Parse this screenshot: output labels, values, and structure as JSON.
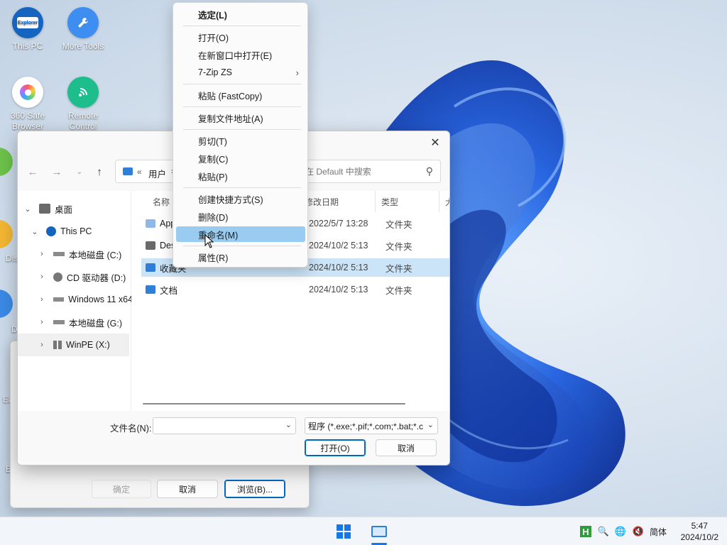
{
  "desktop": {
    "icons": [
      {
        "label": "This PC",
        "icon": "explorer-icon",
        "badge": "Explorer"
      },
      {
        "label": "More Tools",
        "icon": "wrench-icon"
      },
      {
        "label": "360 Safe Browser",
        "icon": "browser-icon"
      },
      {
        "label": "Remote Control",
        "icon": "remote-control-icon"
      }
    ],
    "partial_labels": [
      "Dis",
      "D",
      "Ea",
      "E"
    ]
  },
  "context_menu": {
    "items": [
      {
        "label": "选定(L)",
        "bold": true
      },
      {
        "label": "打开(O)"
      },
      {
        "label": "在新窗口中打开(E)"
      },
      {
        "label": "7-Zip ZS",
        "submenu": true
      },
      {
        "label": "粘贴 (FastCopy)"
      },
      {
        "label": "复制文件地址(A)"
      },
      {
        "label": "剪切(T)"
      },
      {
        "label": "复制(C)"
      },
      {
        "label": "粘贴(P)"
      },
      {
        "label": "创建快捷方式(S)"
      },
      {
        "label": "删除(D)"
      },
      {
        "label": "重命名(M)",
        "highlighted": true
      },
      {
        "label": "属性(R)"
      }
    ]
  },
  "file_dialog": {
    "address": {
      "prefix": "«",
      "crumb": "用户",
      "sep": "›"
    },
    "search_placeholder": "在 Default 中搜索",
    "nav_tree": [
      {
        "label": "桌面",
        "icon": "desktop-icon"
      },
      {
        "label": "This PC",
        "icon": "this-pc-icon"
      },
      {
        "label": "本地磁盘 (C:)",
        "icon": "drive-icon"
      },
      {
        "label": "CD 驱动器 (D:)",
        "icon": "cd-drive-icon"
      },
      {
        "label": "Windows 11 x64",
        "icon": "drive-icon"
      },
      {
        "label": "本地磁盘 (G:)",
        "icon": "drive-icon"
      },
      {
        "label": "WinPE (X:)",
        "icon": "winpe-drive-icon"
      }
    ],
    "columns": {
      "name": "名称",
      "date": "修改日期",
      "type": "类型",
      "size": "大"
    },
    "files": [
      {
        "name": "App",
        "date": "2022/5/7 13:28",
        "type": "文件夹",
        "icon": "folder-icon"
      },
      {
        "name": "Des",
        "date": "2024/10/2 5:13",
        "type": "文件夹",
        "icon": "desktop-folder-icon"
      },
      {
        "name": "收藏夹",
        "date": "2024/10/2 5:13",
        "type": "文件夹",
        "icon": "favorites-folder-icon",
        "selected": true
      },
      {
        "name": "文档",
        "date": "2024/10/2 5:13",
        "type": "文件夹",
        "icon": "documents-folder-icon"
      }
    ],
    "filename_label": "文件名(N):",
    "filename_value": "",
    "filetype_value": "程序 (*.exe;*.pif;*.com;*.bat;*.c",
    "open_button": "打开(O)",
    "cancel_button": "取消"
  },
  "browse_dialog": {
    "ok_button": "确定",
    "cancel_button": "取消",
    "browse_button": "浏览(B)..."
  },
  "taskbar": {
    "tray": {
      "ime": "简体"
    },
    "clock": {
      "time": "5:47",
      "date": "2024/10/2"
    }
  },
  "colors": {
    "accent": "#0067c0",
    "selection": "#cce4f7",
    "menu_highlight": "#99ccf0",
    "folder": "#f5c242",
    "blue_folder": "#2f7fd8"
  }
}
